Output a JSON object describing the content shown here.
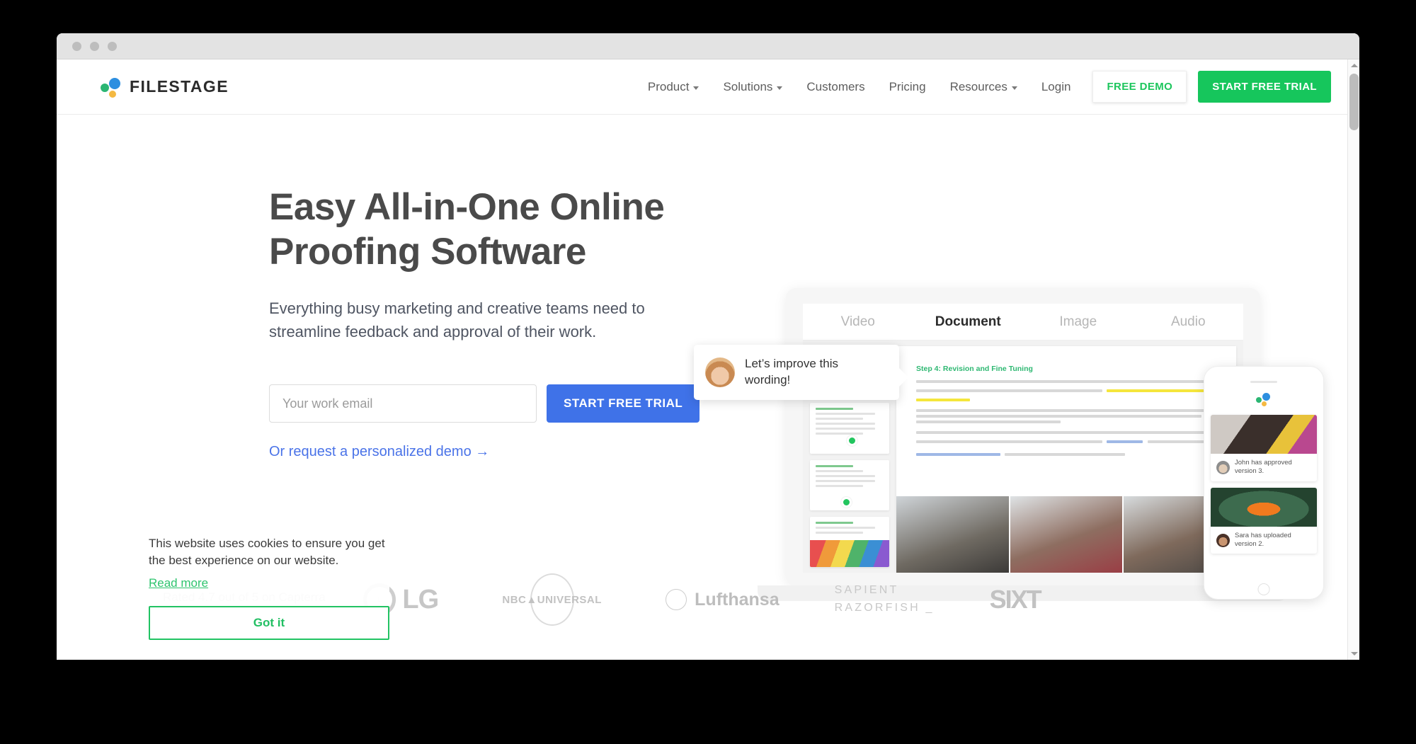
{
  "browser": {
    "window_dots": [
      "dot-1",
      "dot-2",
      "dot-3"
    ],
    "scrollbar": {
      "up_icon": "triangle-up-icon",
      "down_icon": "triangle-down-icon"
    }
  },
  "header": {
    "logo_text": "FILESTAGE",
    "nav": [
      {
        "label": "Product",
        "has_caret": true
      },
      {
        "label": "Solutions",
        "has_caret": true
      },
      {
        "label": "Customers",
        "has_caret": false
      },
      {
        "label": "Pricing",
        "has_caret": false
      },
      {
        "label": "Resources",
        "has_caret": true
      },
      {
        "label": "Login",
        "has_caret": false
      }
    ],
    "demo_button": "FREE DEMO",
    "trial_button": "START FREE TRIAL"
  },
  "hero": {
    "title_line1": "Easy All-in-One Online",
    "title_line2": "Proofing Software",
    "subtitle": "Everything busy marketing and creative teams need to streamline feedback and approval of their work.",
    "email_placeholder": "Your work email",
    "email_value": "",
    "cta_button": "START FREE TRIAL",
    "demo_link": "Or request a personalized demo →",
    "rating": "Rated 4.7 out of 5 on Capterra"
  },
  "app_mockup": {
    "tabs": [
      {
        "label": "Video",
        "active": false
      },
      {
        "label": "Document",
        "active": true
      },
      {
        "label": "Image",
        "active": false
      },
      {
        "label": "Audio",
        "active": false
      }
    ],
    "comment": {
      "text": "Let’s improve this wording!"
    },
    "document_heading": "Step 4: Revision and Fine Tuning"
  },
  "phone": {
    "notifications": [
      {
        "text": "John has approved version 3."
      },
      {
        "text": "Sara has uploaded version 2."
      }
    ]
  },
  "clients": [
    {
      "name": "LG",
      "text": "LG"
    },
    {
      "name": "NBC Universal",
      "text": "NBC▲UNIVERSAL"
    },
    {
      "name": "Lufthansa",
      "text": "Lufthansa"
    },
    {
      "name": "Sapient Razorfish",
      "line1": "SAPIENT",
      "line2": "RAZORFISH _"
    },
    {
      "name": "Sixt",
      "text": "SIXT"
    }
  ],
  "cookie_banner": {
    "text": "This website uses cookies to ensure you get the best experience on our website.",
    "read_more": "Read more",
    "accept_button": "Got it"
  },
  "colors": {
    "brand_green": "#16c65c",
    "cta_blue": "#3f72e8",
    "link_blue": "#4a73e8",
    "cookie_green": "#22c363",
    "doc_heading_green": "#2eb872"
  }
}
